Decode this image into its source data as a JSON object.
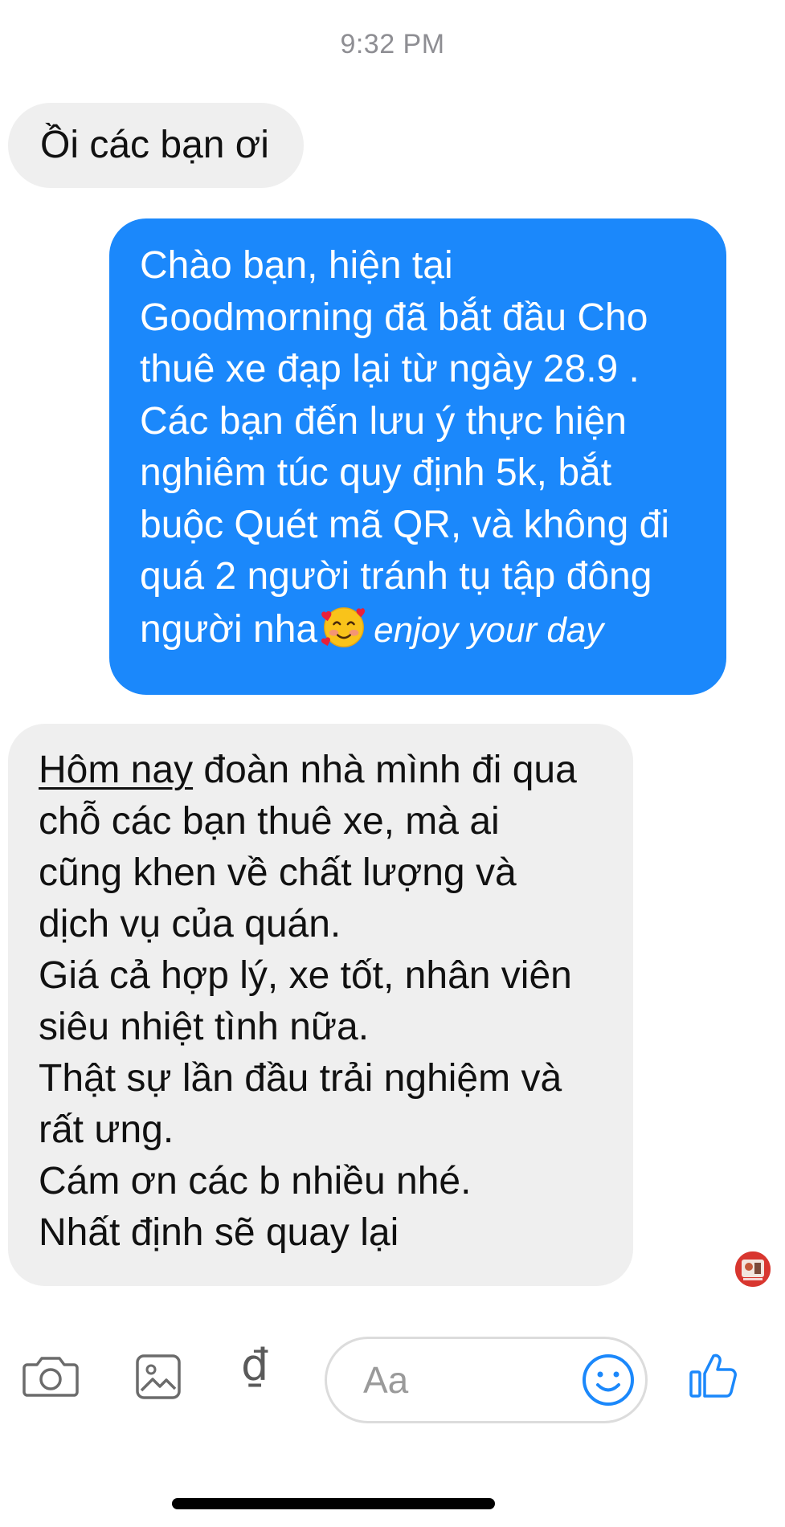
{
  "conversation": {
    "timestamp": "9:32 PM",
    "messages": [
      {
        "direction": "incoming",
        "lines": [
          "Ồi các bạn ơi"
        ]
      },
      {
        "direction": "outgoing",
        "lines": [
          "Chào bạn, hiện tại",
          "Goodmorning đã bắt đầu Cho",
          "thuê xe đạp lại từ ngày 28.9 .",
          "Các bạn đến lưu ý thực hiện",
          "nghiêm túc quy định 5k, bắt",
          "buộc Quét mã QR, và không đi",
          "quá 2 người tránh tụ tập đông"
        ],
        "last_line_text": "người nha",
        "emoji": "smiling-face-with-hearts",
        "last_line_italic": "enjoy your day"
      },
      {
        "direction": "incoming",
        "underlined": "Hôm nay",
        "first_line_rest": " đoàn nhà mình đi qua",
        "lines": [
          "chỗ các bạn thuê xe, mà ai",
          "cũng khen về chất lượng và",
          "dịch vụ của quán.",
          "Giá cả hợp lý, xe tốt, nhân viên",
          "siêu nhiệt tình nữa.",
          "Thật sự lần đầu trải nghiệm và",
          "rất ưng.",
          "Cám ơn các b nhiều nhé.",
          "Nhất định sẽ quay lại"
        ]
      }
    ]
  },
  "composer": {
    "currency_symbol": "₫",
    "input_placeholder": "Aa",
    "icons": [
      "camera-icon",
      "gallery-icon",
      "dong-icon",
      "emoji-icon",
      "thumbs-up-icon"
    ]
  },
  "colors": {
    "outgoing_bubble": "#1b88fb",
    "incoming_bubble": "#efefef",
    "accent": "#1b88fb"
  }
}
